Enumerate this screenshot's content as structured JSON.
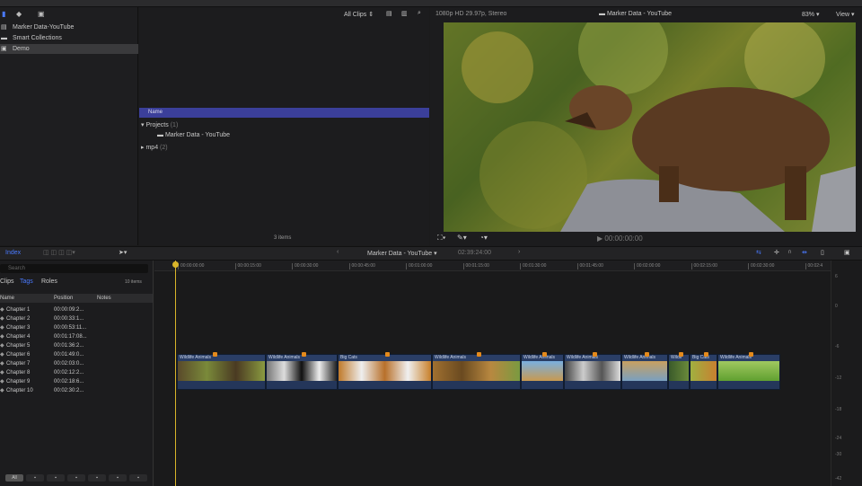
{
  "library": {
    "items": [
      {
        "label": "Marker Data-YouTube",
        "icon": "library-icon"
      },
      {
        "label": "Smart Collections",
        "icon": "folder-icon"
      },
      {
        "label": "Demo",
        "icon": "event-icon",
        "selected": true
      }
    ]
  },
  "browser": {
    "filter": "All Clips",
    "column_header": "Name",
    "groups": [
      {
        "label": "Projects",
        "count": "(1)",
        "expanded": true,
        "children": [
          "Marker Data - YouTube"
        ]
      },
      {
        "label": "mp4",
        "count": "(2)",
        "expanded": false
      }
    ],
    "footer": "3 items"
  },
  "viewer": {
    "format": "1080p HD 29.97p, Stereo",
    "title": "Marker Data - YouTube",
    "zoom": "83%",
    "view_label": "View",
    "timecode": "00:00:00:00"
  },
  "timeline_toolbar": {
    "index_label": "Index",
    "project": "Marker Data - YouTube",
    "duration": "02:39:24:00"
  },
  "index": {
    "search_placeholder": "Search",
    "tabs": [
      "Clips",
      "Tags",
      "Roles"
    ],
    "active_tab": "Tags",
    "count": "10 items",
    "columns": [
      "Name",
      "Position",
      "Notes"
    ],
    "rows": [
      [
        "Chapter 1",
        "00:00:09:2..."
      ],
      [
        "Chapter 2",
        "00:00:33:1..."
      ],
      [
        "Chapter 3",
        "00:00:53:11..."
      ],
      [
        "Chapter 4",
        "00:01:17:08..."
      ],
      [
        "Chapter 5",
        "00:01:36:2..."
      ],
      [
        "Chapter 6",
        "00:01:49:0..."
      ],
      [
        "Chapter 7",
        "00:02:03:0..."
      ],
      [
        "Chapter 8",
        "00:02:12:2..."
      ],
      [
        "Chapter 9",
        "00:02:18:6..."
      ],
      [
        "Chapter 10",
        "00:02:30:2..."
      ]
    ],
    "bottom_filters": [
      "All",
      "marker",
      "todo",
      "chapter",
      "keyword",
      "analysis",
      "caption"
    ]
  },
  "ruler": [
    "00:00:00:00",
    "00:00:15:00",
    "00:00:30:00",
    "00:00:45:00",
    "00:01:00:00",
    "00:01:15:00",
    "00:01:30:00",
    "00:01:45:00",
    "00:02:00:00",
    "00:02:15:00",
    "00:02:30:00",
    "00:02:4"
  ],
  "clips": [
    "Wildlife Animals",
    "Wildlife Animals",
    "Big Cats",
    "Wildlife Animals",
    "Wildlife Animals",
    "Wildlife Animals",
    "Wildlife Animals",
    "Wildli",
    "Big Cats",
    "Wildlife Animals"
  ],
  "meter_scale": [
    "6",
    "0",
    "-6",
    "-12",
    "-18",
    "-24",
    "-30",
    "-42"
  ],
  "colors": {
    "accent": "#3b3f9a",
    "clip": "#24365a",
    "marker": "#e48a1c",
    "playhead": "#d9b52a"
  }
}
